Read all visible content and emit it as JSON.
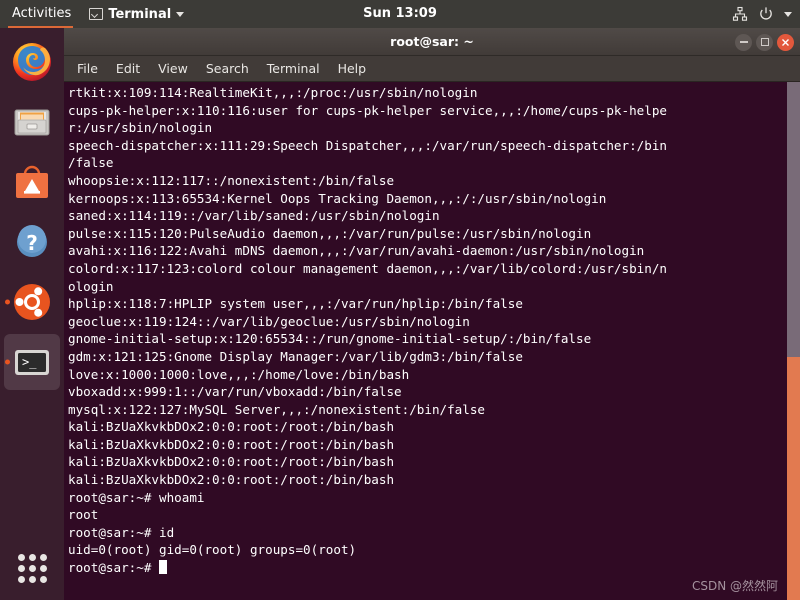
{
  "topbar": {
    "activities": "Activities",
    "app_name": "Terminal",
    "app_icon": "terminal-icon",
    "clock": "Sun 13:09",
    "tray_icons": [
      "network-icon",
      "power-icon",
      "chevron-down-icon"
    ]
  },
  "dock": {
    "items": [
      {
        "name": "firefox",
        "label": "Firefox",
        "running": false,
        "active": false
      },
      {
        "name": "files",
        "label": "Files",
        "running": false,
        "active": false
      },
      {
        "name": "software",
        "label": "Ubuntu Software",
        "running": false,
        "active": false
      },
      {
        "name": "help",
        "label": "Help",
        "running": false,
        "active": false
      },
      {
        "name": "ubuntu",
        "label": "Ubuntu",
        "running": true,
        "active": false
      },
      {
        "name": "terminal",
        "label": "Terminal",
        "running": true,
        "active": true
      }
    ],
    "show_apps_label": "Show Applications"
  },
  "window": {
    "title": "root@sar: ~",
    "controls": {
      "minimize": "–",
      "maximize": "□",
      "close": "✕"
    },
    "menu": [
      "File",
      "Edit",
      "View",
      "Search",
      "Terminal",
      "Help"
    ]
  },
  "terminal": {
    "lines": [
      "rtkit:x:109:114:RealtimeKit,,,:/proc:/usr/sbin/nologin",
      "cups-pk-helper:x:110:116:user for cups-pk-helper service,,,:/home/cups-pk-helpe",
      "r:/usr/sbin/nologin",
      "speech-dispatcher:x:111:29:Speech Dispatcher,,,:/var/run/speech-dispatcher:/bin",
      "/false",
      "whoopsie:x:112:117::/nonexistent:/bin/false",
      "kernoops:x:113:65534:Kernel Oops Tracking Daemon,,,:/:/usr/sbin/nologin",
      "saned:x:114:119::/var/lib/saned:/usr/sbin/nologin",
      "pulse:x:115:120:PulseAudio daemon,,,:/var/run/pulse:/usr/sbin/nologin",
      "avahi:x:116:122:Avahi mDNS daemon,,,:/var/run/avahi-daemon:/usr/sbin/nologin",
      "colord:x:117:123:colord colour management daemon,,,:/var/lib/colord:/usr/sbin/n",
      "ologin",
      "hplip:x:118:7:HPLIP system user,,,:/var/run/hplip:/bin/false",
      "geoclue:x:119:124::/var/lib/geoclue:/usr/sbin/nologin",
      "gnome-initial-setup:x:120:65534::/run/gnome-initial-setup/:/bin/false",
      "gdm:x:121:125:Gnome Display Manager:/var/lib/gdm3:/bin/false",
      "love:x:1000:1000:love,,,:/home/love:/bin/bash",
      "vboxadd:x:999:1::/var/run/vboxadd:/bin/false",
      "mysql:x:122:127:MySQL Server,,,:/nonexistent:/bin/false",
      "kali:BzUaXkvkbDOx2:0:0:root:/root:/bin/bash",
      "kali:BzUaXkvkbDOx2:0:0:root:/root:/bin/bash",
      "kali:BzUaXkvkbDOx2:0:0:root:/root:/bin/bash",
      "kali:BzUaXkvkbDOx2:0:0:root:/root:/bin/bash",
      "root@sar:~# whoami",
      "root",
      "root@sar:~# id",
      "uid=0(root) gid=0(root) groups=0(root)"
    ],
    "prompt": "root@sar:~# ",
    "cursor": "block-cursor"
  },
  "watermark": "CSDN @然然阿",
  "colors": {
    "terminal_bg": "#300a24",
    "topbar_bg": "#3c3b37",
    "accent_orange": "#e95420",
    "titlebar_bg": "#413b38",
    "scrollbar_thumb": "#e27a50",
    "scrollbar_track": "#796b78"
  }
}
